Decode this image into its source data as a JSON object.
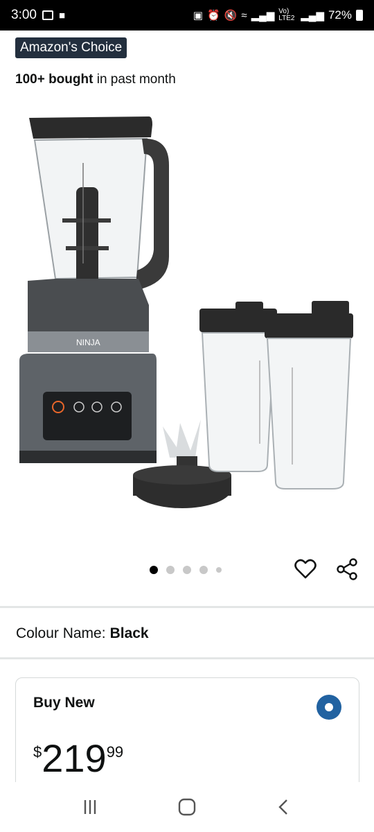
{
  "status_bar": {
    "time": "3:00",
    "network": "Vo) LTE2",
    "battery": "72%"
  },
  "product": {
    "badge": "Amazon's Choice",
    "bought_bold": "100+ bought",
    "bought_rest": " in past month",
    "image_icon": "blender-product-image"
  },
  "carousel": {
    "dot_count": 5,
    "active_index": 0
  },
  "colour": {
    "label": "Colour Name:",
    "value": "Black"
  },
  "buy_box": {
    "title": "Buy New",
    "currency": "$",
    "price_whole": "219",
    "price_fraction": "99"
  },
  "icons": {
    "wishlist": "heart-icon",
    "share": "share-icon",
    "nav_recents": "recents-icon",
    "nav_home": "home-icon",
    "nav_back": "back-icon"
  },
  "colors": {
    "badge_bg": "#232f3e",
    "radio_selected": "#2162a1",
    "divider": "#e3e6e6"
  }
}
